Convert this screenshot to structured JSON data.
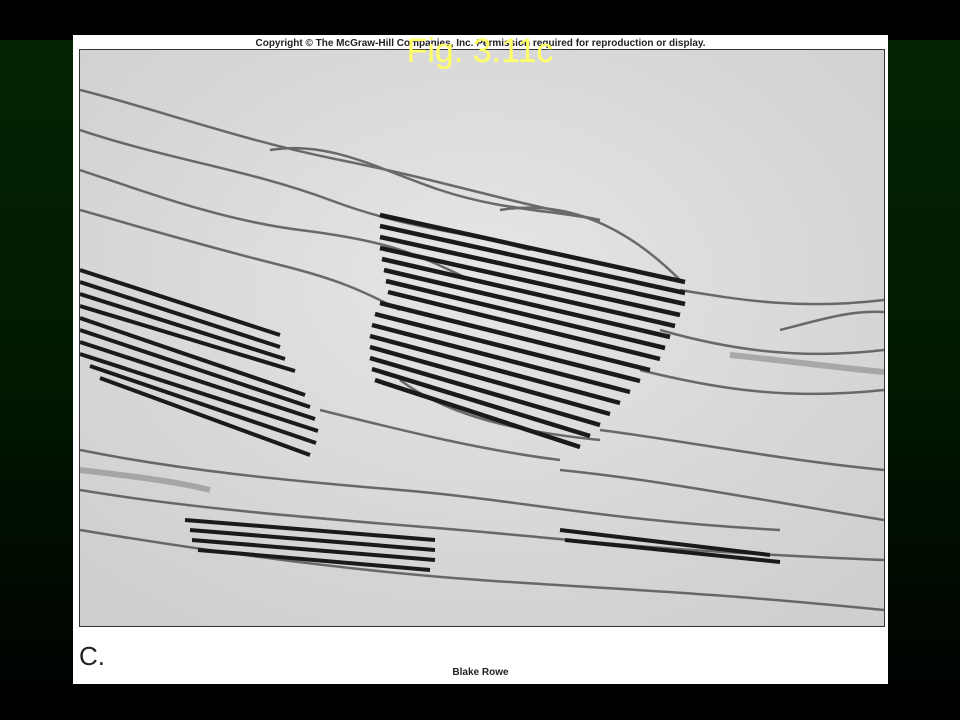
{
  "slide": {
    "title": "Fig. 3.11c",
    "title_color": "#ffff66",
    "background_color": "#022402"
  },
  "figure": {
    "copyright": "Copyright © The McGraw-Hill Companies, Inc. Permission required for reproduction or display.",
    "panel_label": "C.",
    "credit": "Blake Rowe",
    "image_subject": "electron-micrograph"
  }
}
